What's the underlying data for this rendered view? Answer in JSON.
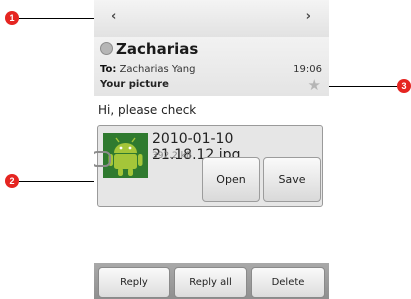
{
  "nav": {
    "prev_glyph": "‹",
    "next_glyph": "›"
  },
  "header": {
    "sender": "Zacharias",
    "to_label": "To:",
    "to_value": "Zacharias Yang",
    "time": "19:06",
    "subject": "Your picture",
    "star_glyph": "★"
  },
  "message": {
    "body": "Hi, please check"
  },
  "attachment": {
    "filename": "2010-01-10 21.18.12.jpg",
    "size": "392.2 kB",
    "open_label": "Open",
    "save_label": "Save"
  },
  "actions": {
    "reply": "Reply",
    "reply_all": "Reply all",
    "delete": "Delete"
  },
  "callouts": [
    "1",
    "2",
    "3"
  ],
  "colors": {
    "callout": "#e52521",
    "android_green": "#a4c639"
  }
}
